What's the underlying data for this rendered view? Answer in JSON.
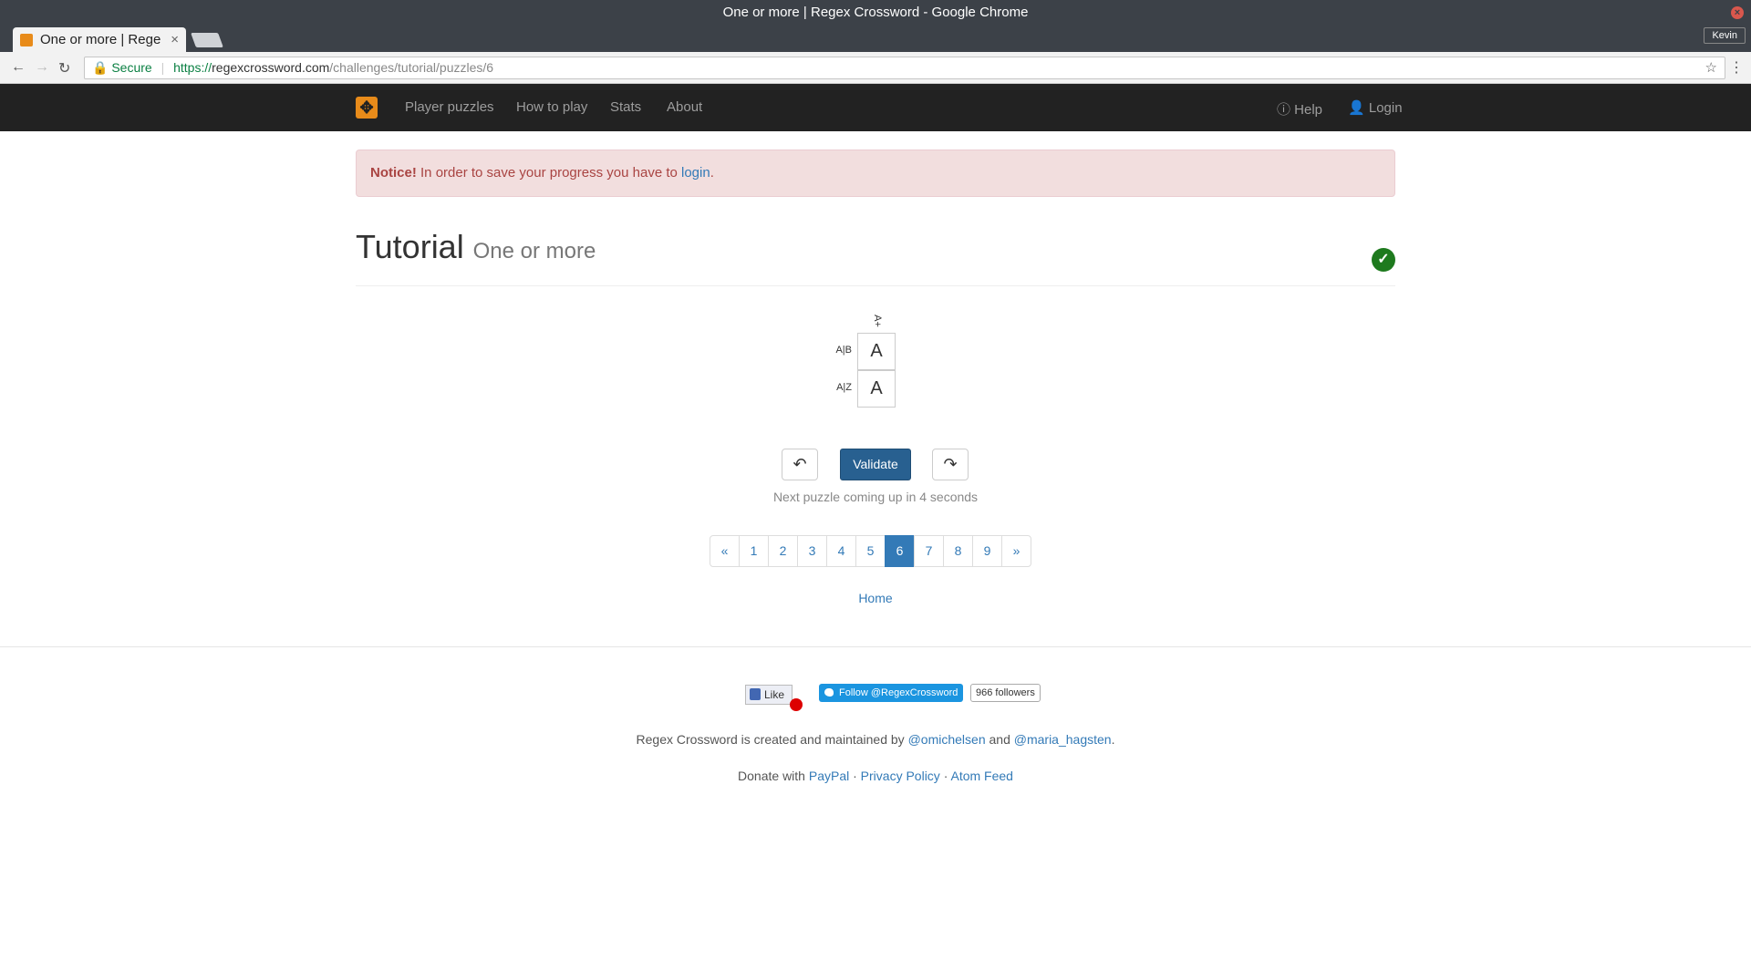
{
  "window": {
    "title": "One or more | Regex Crossword - Google Chrome",
    "profile": "Kevin"
  },
  "tab": {
    "title": "One or more | Rege"
  },
  "address_bar": {
    "secure_label": "Secure",
    "url_scheme": "https://",
    "url_host": "regexcrossword.com",
    "url_path": "/challenges/tutorial/puzzles/6"
  },
  "navbar": {
    "links": [
      "Player puzzles",
      "How to play",
      "Stats",
      "About"
    ],
    "help": "Help",
    "login": "Login"
  },
  "notice": {
    "bold": "Notice!",
    "text": " In order to save your progress you have to ",
    "link": "login",
    "end": "."
  },
  "header": {
    "title": "Tutorial",
    "subtitle": "One or more",
    "solved": true
  },
  "puzzle": {
    "column_clue": "A+",
    "rows": [
      {
        "clue": "A|B",
        "value": "A"
      },
      {
        "clue": "A|Z",
        "value": "A"
      }
    ]
  },
  "controls": {
    "validate": "Validate",
    "next_message": "Next puzzle coming up in 4 seconds"
  },
  "pagination": {
    "prev": "«",
    "pages": [
      "1",
      "2",
      "3",
      "4",
      "5",
      "6",
      "7",
      "8",
      "9"
    ],
    "active": "6",
    "next": "»"
  },
  "home_link": "Home",
  "footer": {
    "fb_like": "Like",
    "twitter_follow": "Follow @RegexCrossword",
    "twitter_followers": "966 followers",
    "credits_prefix": "Regex Crossword is created and maintained by ",
    "author1": "@omichelsen",
    "credits_and": " and ",
    "author2": "@maria_hagsten",
    "credits_end": ".",
    "donate_prefix": "Donate with ",
    "paypal": "PayPal",
    "privacy": "Privacy Policy",
    "atom": "Atom Feed",
    "dot": " · "
  },
  "colors": {
    "accent": "#337ab7",
    "success": "#1e7a1e",
    "brand": "#e88b1a"
  }
}
